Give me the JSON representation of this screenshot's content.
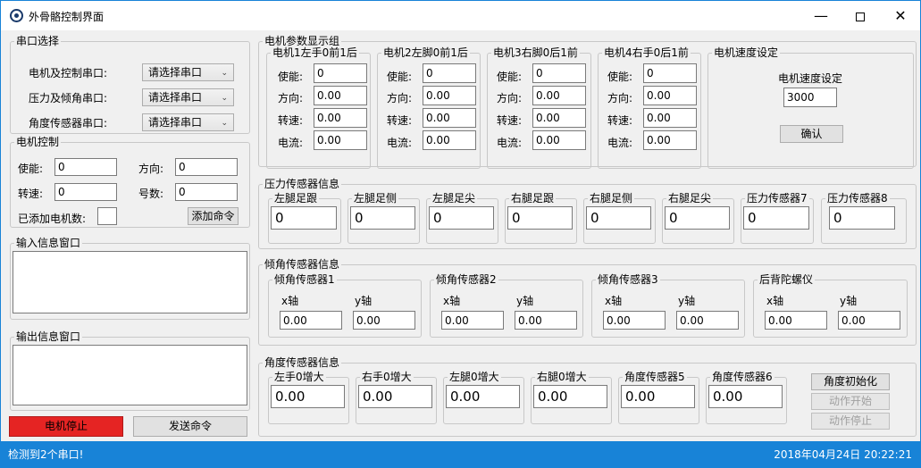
{
  "window": {
    "title": "外骨骼控制界面",
    "minimize_icon": "minimize-icon",
    "maximize_icon": "maximize-icon",
    "close_icon": "close-icon"
  },
  "serial": {
    "legend": "串口选择",
    "rows": [
      {
        "label": "电机及控制串口:",
        "value": "请选择串口"
      },
      {
        "label": "压力及倾角串口:",
        "value": "请选择串口"
      },
      {
        "label": "角度传感器串口:",
        "value": "请选择串口"
      }
    ]
  },
  "motor_control": {
    "legend": "电机控制",
    "enable_label": "使能:",
    "enable_value": "0",
    "direction_label": "方向:",
    "direction_value": "0",
    "speed_label": "转速:",
    "speed_value": "0",
    "number_label": "号数:",
    "number_value": "0",
    "added_label": "已添加电机数:",
    "added_value": "",
    "add_button": "添加命令"
  },
  "input_window": {
    "legend": "输入信息窗口",
    "content": ""
  },
  "output_window": {
    "legend": "输出信息窗口",
    "content": ""
  },
  "buttons": {
    "stop": "电机停止",
    "send": "发送命令"
  },
  "motor_params": {
    "legend": "电机参数显示组",
    "field_labels": [
      "使能:",
      "方向:",
      "转速:",
      "电流:"
    ],
    "motors": [
      {
        "name": "电机1左手0前1后",
        "values": [
          "0",
          "0.00",
          "0.00",
          "0.00"
        ]
      },
      {
        "name": "电机2左脚0前1后",
        "values": [
          "0",
          "0.00",
          "0.00",
          "0.00"
        ]
      },
      {
        "name": "电机3右脚0后1前",
        "values": [
          "0",
          "0.00",
          "0.00",
          "0.00"
        ]
      },
      {
        "name": "电机4右手0后1前",
        "values": [
          "0",
          "0.00",
          "0.00",
          "0.00"
        ]
      }
    ]
  },
  "speed_setting": {
    "legend": "电机速度设定",
    "label": "电机速度设定",
    "value": "3000",
    "button": "确认"
  },
  "pressure": {
    "legend": "压力传感器信息",
    "sensors": [
      {
        "name": "左腿足跟",
        "value": "0"
      },
      {
        "name": "左腿足侧",
        "value": "0"
      },
      {
        "name": "左腿足尖",
        "value": "0"
      },
      {
        "name": "右腿足跟",
        "value": "0"
      },
      {
        "name": "右腿足侧",
        "value": "0"
      },
      {
        "name": "右腿足尖",
        "value": "0"
      },
      {
        "name": "压力传感器7",
        "value": "0"
      },
      {
        "name": "压力传感器8",
        "value": "0"
      }
    ]
  },
  "tilt": {
    "legend": "倾角传感器信息",
    "x_label": "x轴",
    "y_label": "y轴",
    "sensors": [
      {
        "name": "倾角传感器1",
        "x": "0.00",
        "y": "0.00"
      },
      {
        "name": "倾角传感器2",
        "x": "0.00",
        "y": "0.00"
      },
      {
        "name": "倾角传感器3",
        "x": "0.00",
        "y": "0.00"
      },
      {
        "name": "后背陀螺仪",
        "x": "0.00",
        "y": "0.00"
      }
    ]
  },
  "angle": {
    "legend": "角度传感器信息",
    "sensors": [
      {
        "name": "左手0增大",
        "value": "0.00"
      },
      {
        "name": "右手0增大",
        "value": "0.00"
      },
      {
        "name": "左腿0增大",
        "value": "0.00"
      },
      {
        "name": "右腿0增大",
        "value": "0.00"
      },
      {
        "name": "角度传感器5",
        "value": "0.00"
      },
      {
        "name": "角度传感器6",
        "value": "0.00"
      }
    ],
    "init_button": "角度初始化",
    "start_button": "动作开始",
    "stop_button": "动作停止"
  },
  "status": {
    "left": "检测到2个串口!",
    "right": "2018年04月24日  20:22:21"
  },
  "colors": {
    "accent": "#1883d7",
    "stop_button": "#e52423"
  }
}
